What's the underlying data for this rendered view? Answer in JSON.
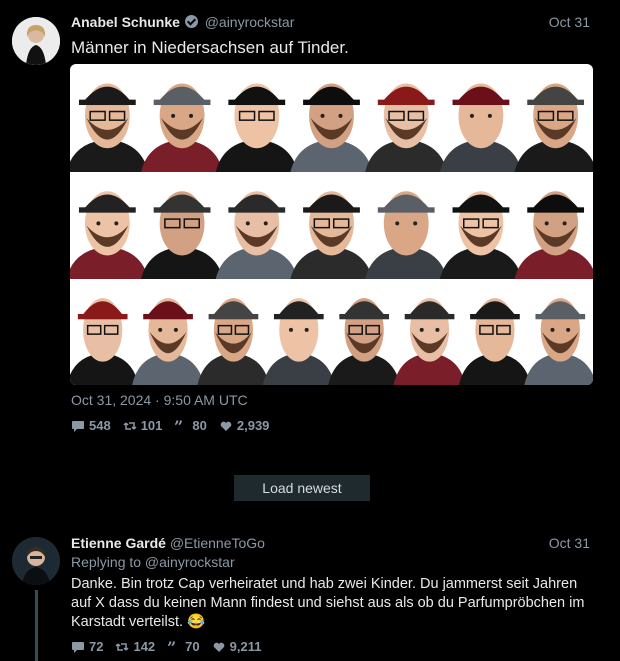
{
  "tweet1": {
    "author_name": "Anabel Schunke",
    "author_handle": "@ainyrockstar",
    "date": "Oct 31",
    "text": "Männer in Niedersachsen auf Tinder.",
    "timestamp": "Oct 31, 2024 · 9:50 AM UTC",
    "stats": {
      "replies": "548",
      "retweets": "101",
      "quotes": "80",
      "likes": "2,939"
    },
    "media_faces": 22
  },
  "load_newest": "Load newest",
  "tweet2": {
    "author_name": "Etienne Gardé",
    "author_handle": "@EtienneToGo",
    "date": "Oct 31",
    "replying_to": "Replying to @ainyrockstar",
    "text": "Danke. Bin trotz Cap verheiratet und hab zwei Kinder. Du jammerst seit Jahren auf X dass du keinen Mann findest und  siehst aus als ob du Parfumpröbchen im Karstadt verteilst. 😂",
    "stats": {
      "replies": "72",
      "retweets": "142",
      "quotes": "70",
      "likes": "9,211"
    }
  },
  "colors": {
    "background": "#000000",
    "text": "#e7e9ea",
    "muted": "#8b98a5",
    "button": "#1e2a2d"
  }
}
